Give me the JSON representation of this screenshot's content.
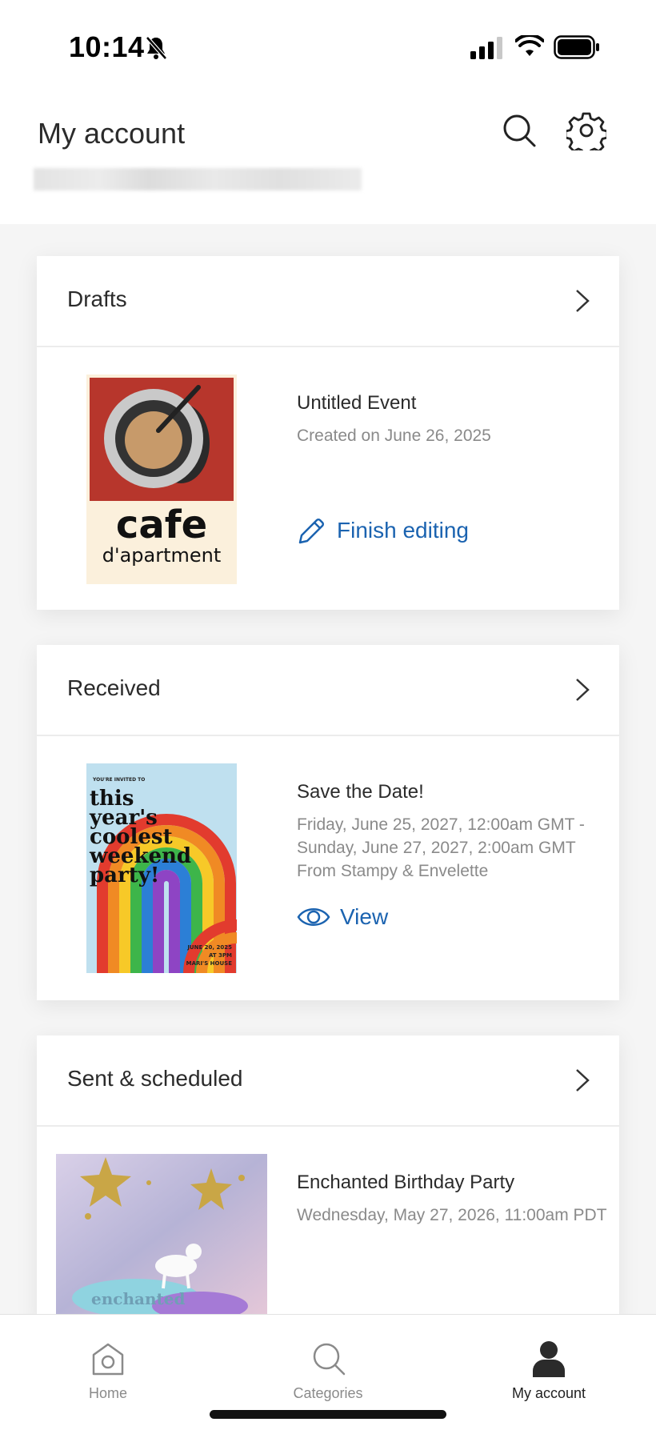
{
  "status_bar": {
    "time": "10:14"
  },
  "header": {
    "title": "My account"
  },
  "drafts": {
    "title": "Drafts",
    "item": {
      "thumb_line1": "cafe",
      "thumb_line2": "d'apartment",
      "title": "Untitled Event",
      "meta": "Created on June 26, 2025",
      "action": "Finish editing"
    }
  },
  "received": {
    "title": "Received",
    "item": {
      "thumb_small": "YOU'RE INVITED TO",
      "thumb_lines": [
        "this",
        "year's",
        "coolest",
        "weekend",
        "party!"
      ],
      "thumb_date": "JUNE 20, 2025",
      "thumb_time": "AT 3PM",
      "thumb_place": "MARI'S HOUSE",
      "title": "Save the Date!",
      "meta_line1": "Friday, June 25, 2027, 12:00am GMT -",
      "meta_line2": "Sunday, June 27, 2027, 2:00am GMT",
      "meta_line3": "From Stampy & Envelette",
      "action": "View"
    }
  },
  "sent": {
    "title": "Sent & scheduled",
    "item": {
      "thumb_text": "enchanted",
      "title": "Enchanted Birthday Party",
      "meta": "Wednesday, May 27, 2026, 11:00am PDT"
    }
  },
  "tabs": [
    {
      "label": "Home",
      "icon": "home-icon"
    },
    {
      "label": "Categories",
      "icon": "search-icon"
    },
    {
      "label": "My account",
      "icon": "account-icon",
      "active": true
    }
  ],
  "colors": {
    "accent": "#1b63b0",
    "text": "#2b2b2b",
    "muted": "#8a8a8a"
  }
}
